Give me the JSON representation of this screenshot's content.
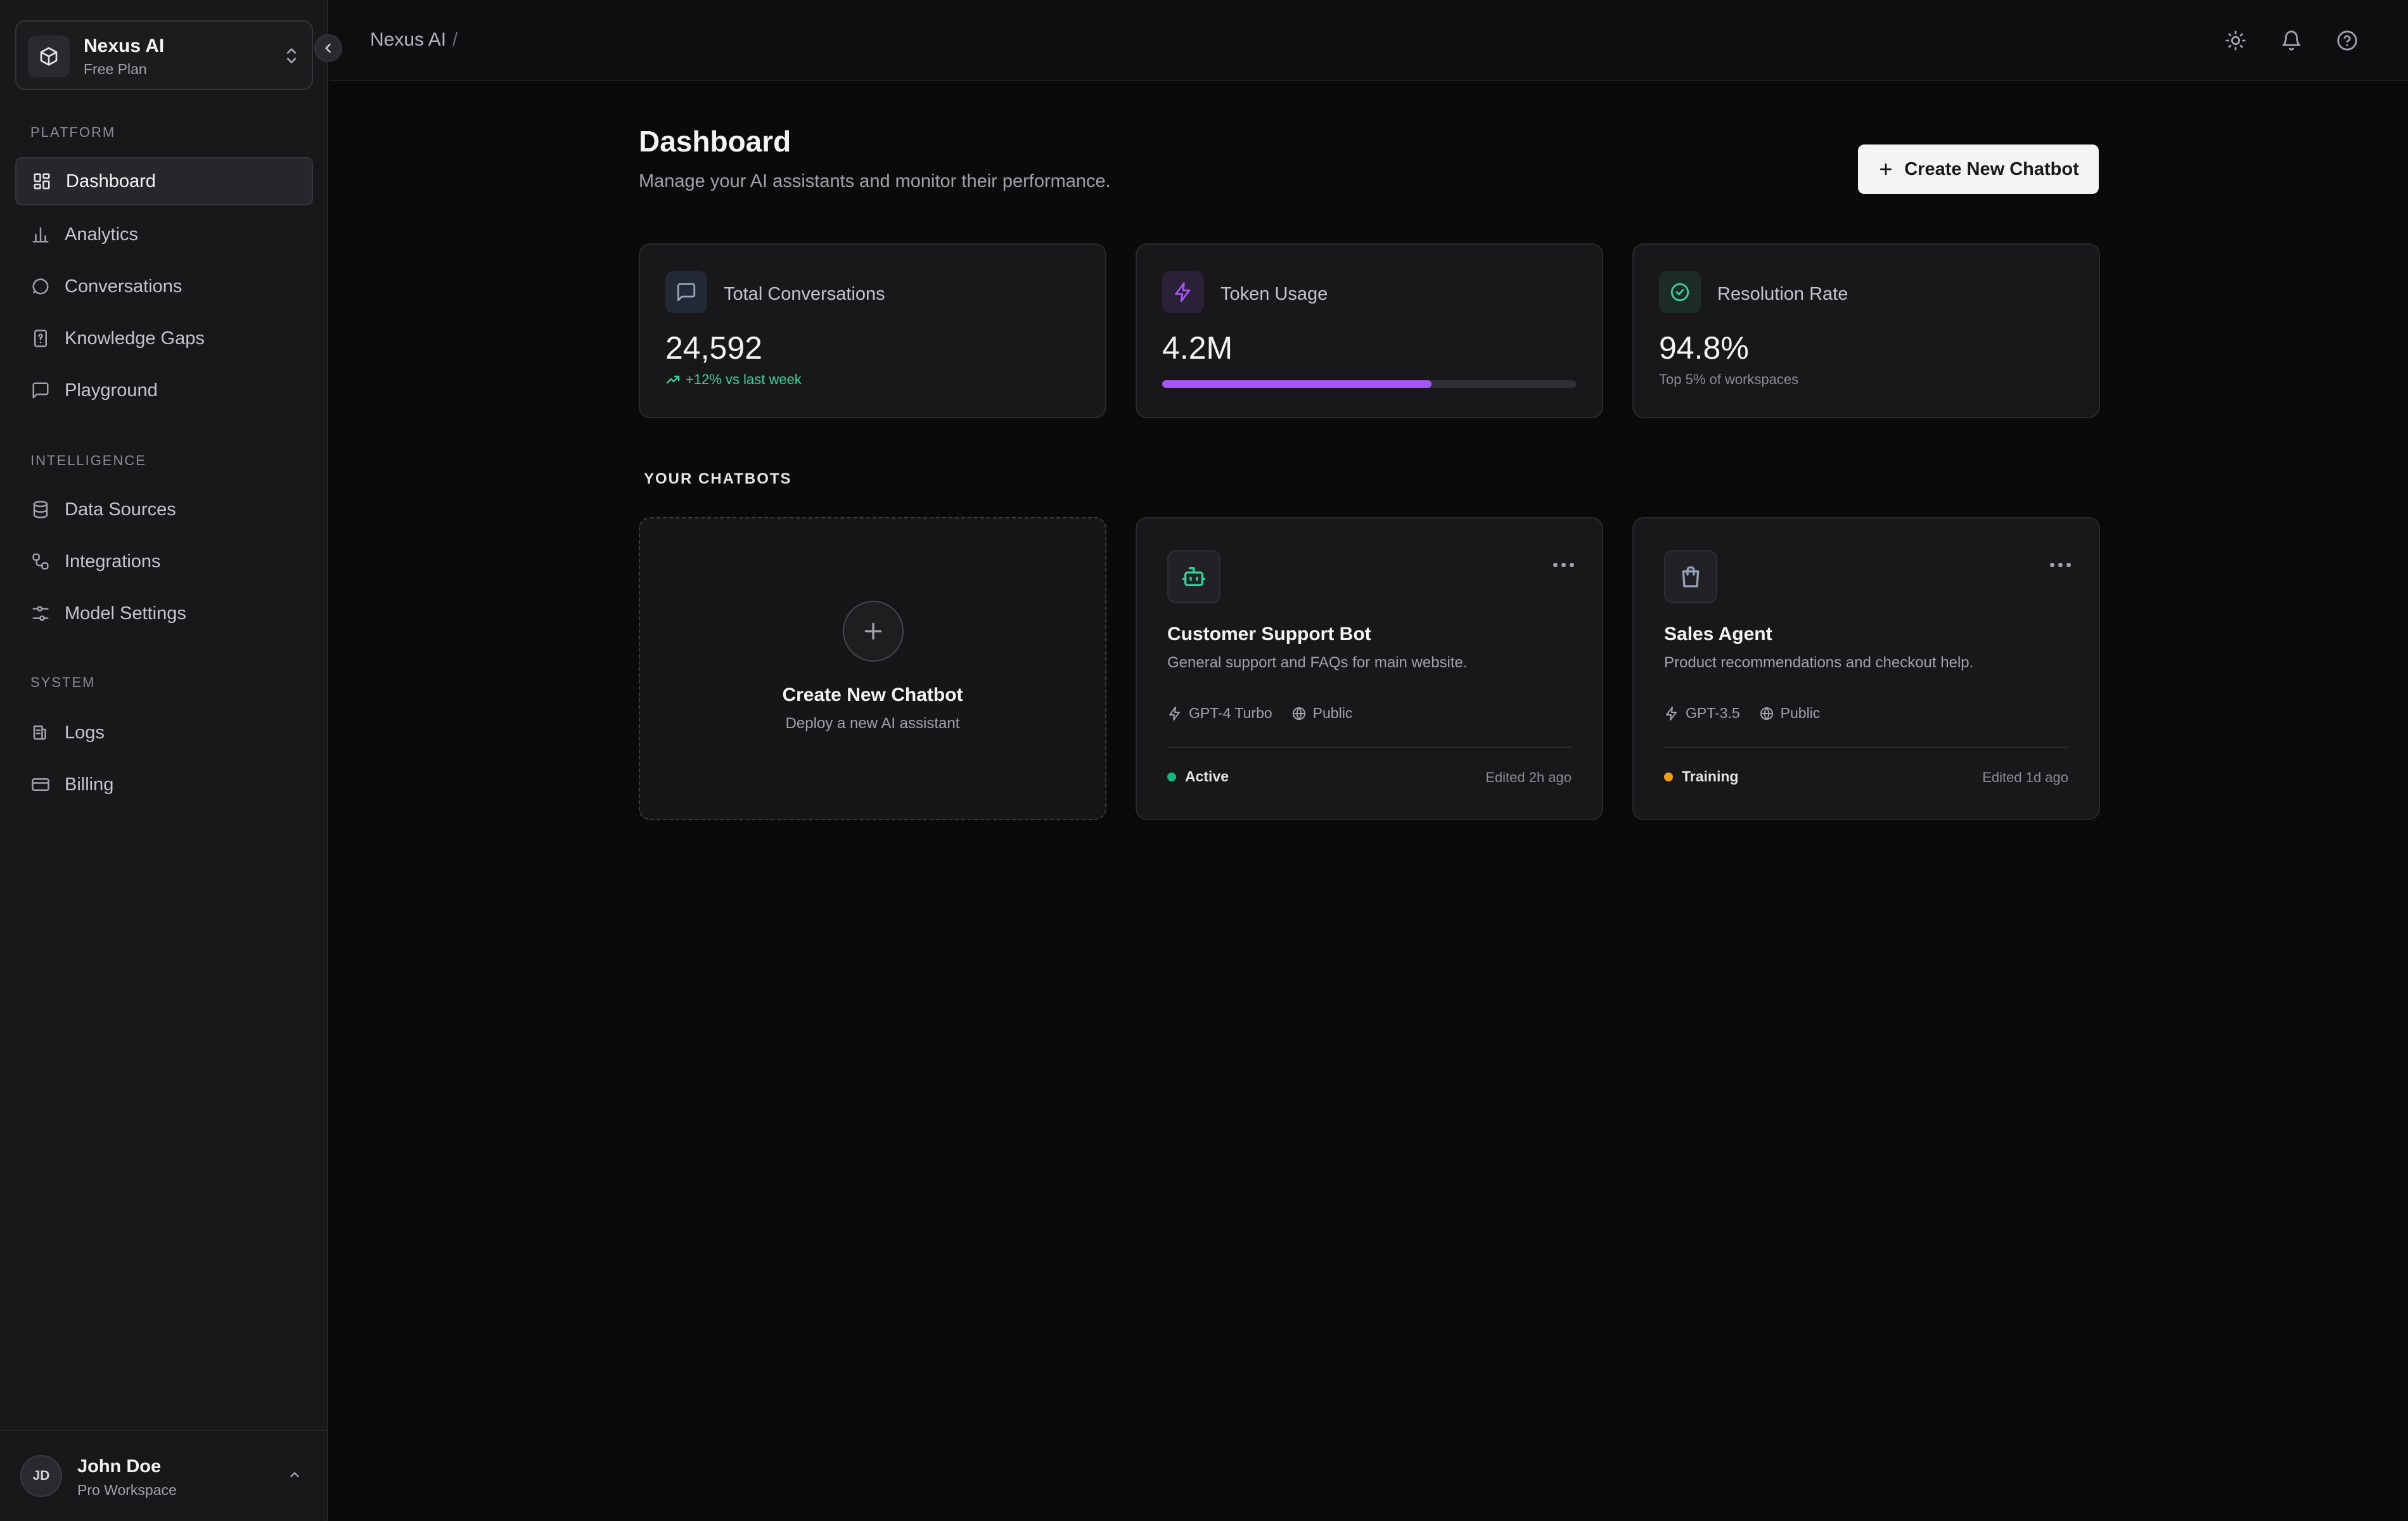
{
  "workspace": {
    "name": "Nexus AI",
    "plan": "Free Plan"
  },
  "sidebar": {
    "sections": [
      {
        "label": "PLATFORM",
        "items": [
          {
            "label": "Dashboard",
            "icon": "dashboard-icon",
            "active": true
          },
          {
            "label": "Analytics",
            "icon": "bar-chart-icon"
          },
          {
            "label": "Conversations",
            "icon": "message-circle-icon"
          },
          {
            "label": "Knowledge Gaps",
            "icon": "file-question-icon"
          },
          {
            "label": "Playground",
            "icon": "message-square-icon"
          }
        ]
      },
      {
        "label": "INTELLIGENCE",
        "items": [
          {
            "label": "Data Sources",
            "icon": "database-icon"
          },
          {
            "label": "Integrations",
            "icon": "workflow-icon"
          },
          {
            "label": "Model Settings",
            "icon": "sliders-icon"
          }
        ]
      },
      {
        "label": "SYSTEM",
        "items": [
          {
            "label": "Logs",
            "icon": "logs-icon"
          },
          {
            "label": "Billing",
            "icon": "credit-card-icon"
          }
        ]
      }
    ]
  },
  "user": {
    "initials": "JD",
    "name": "John Doe",
    "workspace": "Pro Workspace"
  },
  "topbar": {
    "breadcrumb": "Nexus AI",
    "separator": "/"
  },
  "page": {
    "title": "Dashboard",
    "subtitle": "Manage your AI assistants and monitor their performance.",
    "create_button": "Create New Chatbot"
  },
  "stats": [
    {
      "label": "Total Conversations",
      "value": "24,592",
      "note": "+12% vs last week",
      "icon": "message-square-icon",
      "accent": "#94a3b8"
    },
    {
      "label": "Token Usage",
      "value": "4.2M",
      "progress": 0.65,
      "icon": "zap-icon",
      "accent": "#a855f7"
    },
    {
      "label": "Resolution Rate",
      "value": "94.8%",
      "note": "Top 5% of workspaces",
      "icon": "check-circle-icon",
      "accent": "#34d399"
    }
  ],
  "chatbots_heading": "YOUR CHATBOTS",
  "create_card": {
    "title": "Create New Chatbot",
    "subtitle": "Deploy a new AI assistant"
  },
  "chatbots": [
    {
      "name": "Customer Support Bot",
      "description": "General support and FAQs for main website.",
      "model": "GPT-4 Turbo",
      "visibility": "Public",
      "status": "Active",
      "status_color": "#10b981",
      "edited": "Edited 2h ago",
      "icon": "bot-icon",
      "icon_color": "#34d399"
    },
    {
      "name": "Sales Agent",
      "description": "Product recommendations and checkout help.",
      "model": "GPT-3.5",
      "visibility": "Public",
      "status": "Training",
      "status_color": "#f59e0b",
      "edited": "Edited 1d ago",
      "icon": "shopping-bag-icon",
      "icon_color": "#94a3b8"
    }
  ],
  "colors": {
    "background": "#0a0a0b",
    "sidebar": "#18181b",
    "card": "#18181b",
    "accent_purple": "#a855f7",
    "success": "#34d399"
  }
}
